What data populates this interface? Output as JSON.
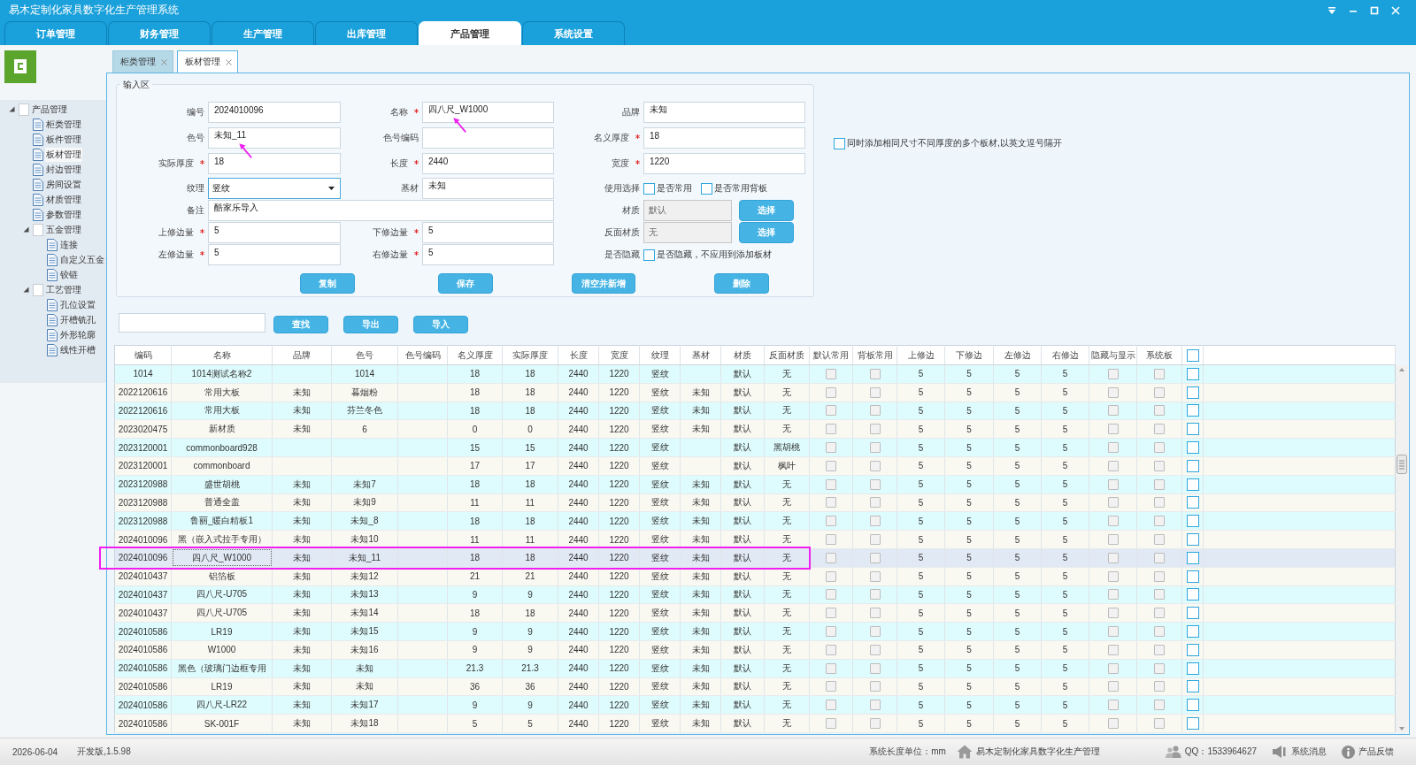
{
  "window": {
    "title": "易木定制化家具数字化生产管理系统"
  },
  "main_tabs": [
    {
      "label": "订单管理",
      "selected": false
    },
    {
      "label": "财务管理",
      "selected": false
    },
    {
      "label": "生产管理",
      "selected": false
    },
    {
      "label": "出库管理",
      "selected": false
    },
    {
      "label": "产品管理",
      "selected": true
    },
    {
      "label": "系统设置",
      "selected": false
    }
  ],
  "sidebar": {
    "tree": [
      {
        "label": "产品管理",
        "selected": false,
        "expanded": true,
        "children": [
          {
            "label": "柜类管理",
            "selected": false
          },
          {
            "label": "板件管理",
            "selected": false
          },
          {
            "label": "板材管理",
            "selected": true
          },
          {
            "label": "封边管理",
            "selected": false
          },
          {
            "label": "房间设置",
            "selected": false
          },
          {
            "label": "材质管理",
            "selected": false
          },
          {
            "label": "参数管理",
            "selected": false
          },
          {
            "label": "五金管理",
            "selected": false,
            "expanded": true,
            "children": [
              {
                "label": "连接",
                "selected": false
              },
              {
                "label": "自定义五金",
                "selected": false
              },
              {
                "label": "铰链",
                "selected": false
              }
            ]
          },
          {
            "label": "工艺管理",
            "selected": false,
            "expanded": true,
            "children": [
              {
                "label": "孔位设置",
                "selected": false
              },
              {
                "label": "开槽铣孔",
                "selected": false
              },
              {
                "label": "外形轮廓",
                "selected": false
              },
              {
                "label": "线性开槽",
                "selected": false
              }
            ]
          }
        ]
      }
    ]
  },
  "sub_tabs": [
    {
      "label": "柜类管理",
      "selected": false
    },
    {
      "label": "板材管理",
      "selected": true
    }
  ],
  "form": {
    "legend": "输入区",
    "rows": [
      [
        {
          "kind": "text",
          "label": "编号",
          "required": false,
          "marked": false,
          "value": "2024010096"
        },
        {
          "kind": "text",
          "label": "名称",
          "required": true,
          "marked": true,
          "value": "四八尺_W1000"
        },
        {
          "kind": "text",
          "label": "品牌",
          "required": false,
          "marked": false,
          "value": "未知"
        }
      ],
      [
        {
          "kind": "text",
          "label": "色号",
          "required": false,
          "marked": true,
          "value": "未知_11"
        },
        {
          "kind": "text",
          "label": "色号编码",
          "required": false,
          "marked": false
        },
        {
          "kind": "text",
          "label": "名义厚度",
          "required": true,
          "marked": false,
          "value": "18"
        }
      ],
      [
        {
          "kind": "text",
          "label": "实际厚度",
          "required": true,
          "marked": false,
          "value": "18"
        },
        {
          "kind": "text",
          "label": "长度",
          "required": true,
          "marked": false,
          "value": "2440"
        },
        {
          "kind": "text",
          "label": "宽度",
          "required": true,
          "marked": false,
          "value": "1220"
        }
      ],
      [
        {
          "kind": "select",
          "label": "纹理",
          "required": false,
          "marked": false,
          "value": "竖纹"
        },
        {
          "kind": "text",
          "label": "基材",
          "required": false,
          "marked": false,
          "value": "未知"
        },
        {
          "kind": "checks",
          "label": "使用选择",
          "required": false,
          "marked": false,
          "options": [
            {
              "label": "是否常用",
              "checked": false
            },
            {
              "label": "是否常用背板",
              "checked": false
            }
          ]
        }
      ],
      [
        {
          "kind": "wide",
          "label": "备注",
          "required": false,
          "marked": false,
          "value": "酷家乐导入"
        },
        "",
        {
          "kind": "picker",
          "label": "材质",
          "required": false,
          "marked": false,
          "value": "默认",
          "button": "选择"
        }
      ],
      [
        {
          "kind": "text",
          "label": "上修边量",
          "required": true,
          "marked": false,
          "value": "5"
        },
        {
          "kind": "text",
          "label": "下修边量",
          "required": true,
          "marked": false,
          "value": "5"
        },
        {
          "kind": "picker",
          "label": "反面材质",
          "required": false,
          "marked": false,
          "value": "无",
          "button": "选择"
        }
      ],
      [
        {
          "kind": "text",
          "label": "左修边量",
          "required": true,
          "marked": false,
          "value": "5"
        },
        {
          "kind": "text",
          "label": "右修边量",
          "required": true,
          "marked": false,
          "value": "5"
        },
        {
          "kind": "checks",
          "label": "是否隐藏",
          "required": false,
          "marked": false,
          "options": [
            {
              "label": "是否隐藏，不应用到添加板材",
              "checked": false
            }
          ]
        }
      ]
    ],
    "buttons": [
      "复制",
      "保存",
      "清空并新增",
      "删除"
    ]
  },
  "side_option": {
    "label": "同时添加相同尺寸不同厚度的多个板材,以英文逗号隔开",
    "checked": false
  },
  "search": {
    "buttons": [
      "查找",
      "导出",
      "导入"
    ]
  },
  "table": {
    "columns": [
      {
        "label": "编码",
        "kind": "text"
      },
      {
        "label": "名称",
        "kind": "text"
      },
      {
        "label": "品牌",
        "kind": "text"
      },
      {
        "label": "色号",
        "kind": "text"
      },
      {
        "label": "色号编码",
        "kind": "text"
      },
      {
        "label": "名义厚度",
        "kind": "text"
      },
      {
        "label": "实际厚度",
        "kind": "text"
      },
      {
        "label": "长度",
        "kind": "text"
      },
      {
        "label": "宽度",
        "kind": "text"
      },
      {
        "label": "纹理",
        "kind": "text"
      },
      {
        "label": "基材",
        "kind": "text"
      },
      {
        "label": "材质",
        "kind": "text"
      },
      {
        "label": "反面材质",
        "kind": "text"
      },
      {
        "label": "默认常用",
        "kind": "check"
      },
      {
        "label": "背板常用",
        "kind": "check"
      },
      {
        "label": "上修边",
        "kind": "text"
      },
      {
        "label": "下修边",
        "kind": "text"
      },
      {
        "label": "左修边",
        "kind": "text"
      },
      {
        "label": "右修边",
        "kind": "text"
      },
      {
        "label": "隐藏与显示",
        "kind": "check"
      },
      {
        "label": "系统板",
        "kind": "check"
      },
      {
        "kind": "pick",
        "checked": false
      }
    ],
    "rows": [
      {
        "selected": false,
        "cells": [
          "1014",
          "1014测试名称2",
          "",
          "1014",
          "",
          "18",
          "18",
          "2440",
          "1220",
          "竖纹",
          "",
          "默认",
          "无",
          {
            "checked": false
          },
          {
            "checked": false
          },
          "5",
          "5",
          "5",
          "5",
          {
            "checked": false
          },
          {
            "checked": false
          },
          {
            "checked": false
          }
        ]
      },
      {
        "selected": false,
        "cells": [
          "2022120616",
          "常用大板",
          "未知",
          "暮烟粉",
          "",
          "18",
          "18",
          "2440",
          "1220",
          "竖纹",
          "未知",
          "默认",
          "无",
          {
            "checked": false
          },
          {
            "checked": false
          },
          "5",
          "5",
          "5",
          "5",
          {
            "checked": false
          },
          {
            "checked": false
          },
          {
            "checked": false
          }
        ]
      },
      {
        "selected": false,
        "cells": [
          "2022120616",
          "常用大板",
          "未知",
          "芬兰冬色",
          "",
          "18",
          "18",
          "2440",
          "1220",
          "竖纹",
          "未知",
          "默认",
          "无",
          {
            "checked": false
          },
          {
            "checked": false
          },
          "5",
          "5",
          "5",
          "5",
          {
            "checked": false
          },
          {
            "checked": false
          },
          {
            "checked": false
          }
        ]
      },
      {
        "selected": false,
        "cells": [
          "2023020475",
          "新材质",
          "未知",
          "6",
          "",
          "0",
          "0",
          "2440",
          "1220",
          "竖纹",
          "未知",
          "默认",
          "无",
          {
            "checked": false
          },
          {
            "checked": false
          },
          "5",
          "5",
          "5",
          "5",
          {
            "checked": false
          },
          {
            "checked": false
          },
          {
            "checked": false
          }
        ]
      },
      {
        "selected": false,
        "cells": [
          "2023120001",
          "commonboard928",
          "",
          "",
          "",
          "15",
          "15",
          "2440",
          "1220",
          "竖纹",
          "",
          "默认",
          "黑胡桃",
          {
            "checked": false
          },
          {
            "checked": false
          },
          "5",
          "5",
          "5",
          "5",
          {
            "checked": false
          },
          {
            "checked": false
          },
          {
            "checked": false
          }
        ]
      },
      {
        "selected": false,
        "cells": [
          "2023120001",
          "commonboard",
          "",
          "",
          "",
          "17",
          "17",
          "2440",
          "1220",
          "竖纹",
          "",
          "默认",
          "枫叶",
          {
            "checked": false
          },
          {
            "checked": false
          },
          "5",
          "5",
          "5",
          "5",
          {
            "checked": false
          },
          {
            "checked": false
          },
          {
            "checked": false
          }
        ]
      },
      {
        "selected": false,
        "cells": [
          "2023120988",
          "盛世胡桃",
          "未知",
          "未知7",
          "",
          "18",
          "18",
          "2440",
          "1220",
          "竖纹",
          "未知",
          "默认",
          "无",
          {
            "checked": false
          },
          {
            "checked": false
          },
          "5",
          "5",
          "5",
          "5",
          {
            "checked": false
          },
          {
            "checked": false
          },
          {
            "checked": false
          }
        ]
      },
      {
        "selected": false,
        "cells": [
          "2023120988",
          "普通全盖",
          "未知",
          "未知9",
          "",
          "11",
          "11",
          "2440",
          "1220",
          "竖纹",
          "未知",
          "默认",
          "无",
          {
            "checked": false
          },
          {
            "checked": false
          },
          "5",
          "5",
          "5",
          "5",
          {
            "checked": false
          },
          {
            "checked": false
          },
          {
            "checked": false
          }
        ]
      },
      {
        "selected": false,
        "cells": [
          "2023120988",
          "鲁丽_暖白精板1",
          "未知",
          "未知_8",
          "",
          "18",
          "18",
          "2440",
          "1220",
          "竖纹",
          "未知",
          "默认",
          "无",
          {
            "checked": false
          },
          {
            "checked": false
          },
          "5",
          "5",
          "5",
          "5",
          {
            "checked": false
          },
          {
            "checked": false
          },
          {
            "checked": false
          }
        ]
      },
      {
        "selected": false,
        "cells": [
          "2024010096",
          "黑（嵌入式拉手专用）",
          "未知",
          "未知10",
          "",
          "11",
          "11",
          "2440",
          "1220",
          "竖纹",
          "未知",
          "默认",
          "无",
          {
            "checked": false
          },
          {
            "checked": false
          },
          "5",
          "5",
          "5",
          "5",
          {
            "checked": false
          },
          {
            "checked": false
          },
          {
            "checked": false
          }
        ]
      },
      {
        "selected": true,
        "cells": [
          "2024010096",
          "四八尺_W1000",
          "未知",
          "未知_11",
          "",
          "18",
          "18",
          "2440",
          "1220",
          "竖纹",
          "未知",
          "默认",
          "无",
          {
            "checked": false
          },
          {
            "checked": false
          },
          "5",
          "5",
          "5",
          "5",
          {
            "checked": false
          },
          {
            "checked": false
          },
          {
            "checked": false
          }
        ]
      },
      {
        "selected": false,
        "cells": [
          "2024010437",
          "铝箔板",
          "未知",
          "未知12",
          "",
          "21",
          "21",
          "2440",
          "1220",
          "竖纹",
          "未知",
          "默认",
          "无",
          {
            "checked": false
          },
          {
            "checked": false
          },
          "5",
          "5",
          "5",
          "5",
          {
            "checked": false
          },
          {
            "checked": false
          },
          {
            "checked": false
          }
        ]
      },
      {
        "selected": false,
        "cells": [
          "2024010437",
          "四八尺-U705",
          "未知",
          "未知13",
          "",
          "9",
          "9",
          "2440",
          "1220",
          "竖纹",
          "未知",
          "默认",
          "无",
          {
            "checked": false
          },
          {
            "checked": false
          },
          "5",
          "5",
          "5",
          "5",
          {
            "checked": false
          },
          {
            "checked": false
          },
          {
            "checked": false
          }
        ]
      },
      {
        "selected": false,
        "cells": [
          "2024010437",
          "四八尺-U705",
          "未知",
          "未知14",
          "",
          "18",
          "18",
          "2440",
          "1220",
          "竖纹",
          "未知",
          "默认",
          "无",
          {
            "checked": false
          },
          {
            "checked": false
          },
          "5",
          "5",
          "5",
          "5",
          {
            "checked": false
          },
          {
            "checked": false
          },
          {
            "checked": false
          }
        ]
      },
      {
        "selected": false,
        "cells": [
          "2024010586",
          "LR19",
          "未知",
          "未知15",
          "",
          "9",
          "9",
          "2440",
          "1220",
          "竖纹",
          "未知",
          "默认",
          "无",
          {
            "checked": false
          },
          {
            "checked": false
          },
          "5",
          "5",
          "5",
          "5",
          {
            "checked": false
          },
          {
            "checked": false
          },
          {
            "checked": false
          }
        ]
      },
      {
        "selected": false,
        "cells": [
          "2024010586",
          "W1000",
          "未知",
          "未知16",
          "",
          "9",
          "9",
          "2440",
          "1220",
          "竖纹",
          "未知",
          "默认",
          "无",
          {
            "checked": false
          },
          {
            "checked": false
          },
          "5",
          "5",
          "5",
          "5",
          {
            "checked": false
          },
          {
            "checked": false
          },
          {
            "checked": false
          }
        ]
      },
      {
        "selected": false,
        "cells": [
          "2024010586",
          "黑色（玻璃门边框专用",
          "未知",
          "未知",
          "",
          "21.3",
          "21.3",
          "2440",
          "1220",
          "竖纹",
          "未知",
          "默认",
          "无",
          {
            "checked": false
          },
          {
            "checked": false
          },
          "5",
          "5",
          "5",
          "5",
          {
            "checked": false
          },
          {
            "checked": false
          },
          {
            "checked": false
          }
        ]
      },
      {
        "selected": false,
        "cells": [
          "2024010586",
          "LR19",
          "未知",
          "未知",
          "",
          "36",
          "36",
          "2440",
          "1220",
          "竖纹",
          "未知",
          "默认",
          "无",
          {
            "checked": false
          },
          {
            "checked": false
          },
          "5",
          "5",
          "5",
          "5",
          {
            "checked": false
          },
          {
            "checked": false
          },
          {
            "checked": false
          }
        ]
      },
      {
        "selected": false,
        "cells": [
          "2024010586",
          "四八尺-LR22",
          "未知",
          "未知17",
          "",
          "9",
          "9",
          "2440",
          "1220",
          "竖纹",
          "未知",
          "默认",
          "无",
          {
            "checked": false
          },
          {
            "checked": false
          },
          "5",
          "5",
          "5",
          "5",
          {
            "checked": false
          },
          {
            "checked": false
          },
          {
            "checked": false
          }
        ]
      },
      {
        "selected": false,
        "cells": [
          "2024010586",
          "SK-001F",
          "未知",
          "未知18",
          "",
          "5",
          "5",
          "2440",
          "1220",
          "竖纹",
          "未知",
          "默认",
          "无",
          {
            "checked": false
          },
          {
            "checked": false
          },
          "5",
          "5",
          "5",
          "5",
          {
            "checked": false
          },
          {
            "checked": false
          },
          {
            "checked": false
          }
        ]
      }
    ]
  },
  "status_bar": {
    "date": "2026-06-04",
    "version": "开发版,1.5.98",
    "unit": "系统长度单位：mm",
    "company": "易木定制化家具数字化生产管理",
    "qq": "QQ：1533964627",
    "messages": "系统消息",
    "feedback": "产品反馈"
  }
}
